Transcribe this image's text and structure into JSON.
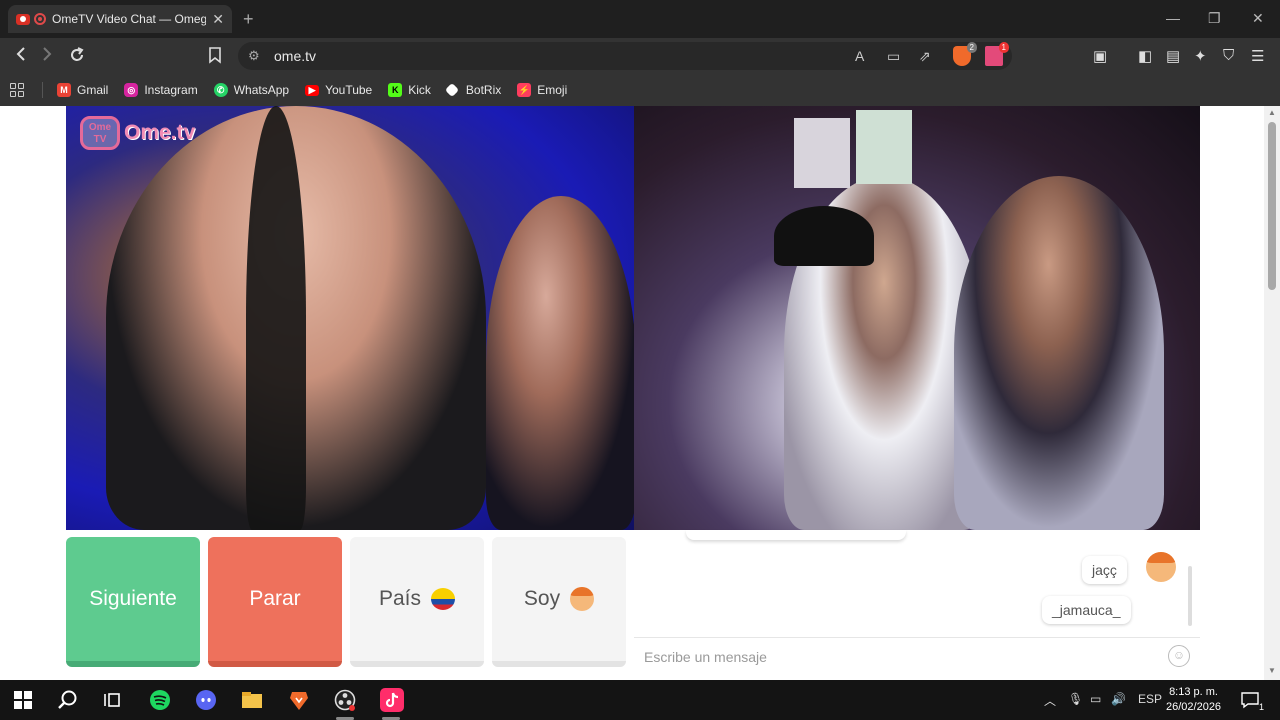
{
  "tab": {
    "title": "OmeTV Video Chat — Omegle",
    "close": "✕",
    "new_tab": "+"
  },
  "window": {
    "minimize": "—",
    "maximize": "❐",
    "close": "✕"
  },
  "address_bar": {
    "url": "ome.tv"
  },
  "extensions": {
    "brave_shields_badge": "2",
    "brave_rewards_badge": "1"
  },
  "bookmarks": [
    {
      "label": "Gmail",
      "icon": "gmail-icon",
      "color": "#ea4335"
    },
    {
      "label": "Instagram",
      "icon": "instagram-icon",
      "color": "#d6249f"
    },
    {
      "label": "WhatsApp",
      "icon": "whatsapp-icon",
      "color": "#25d366"
    },
    {
      "label": "YouTube",
      "icon": "youtube-icon",
      "color": "#ff0000"
    },
    {
      "label": "Kick",
      "icon": "kick-icon",
      "color": "#53fc18"
    },
    {
      "label": "BotRix",
      "icon": "botrix-icon",
      "color": "#ffffff"
    },
    {
      "label": "Emoji",
      "icon": "emoji-icon",
      "color": "#ff3d5e"
    }
  ],
  "site": {
    "logo_box_text": "Ome TV",
    "logo_text": "Ome.tv",
    "controls": {
      "next": "Siguiente",
      "stop": "Parar",
      "country": "País",
      "soy": "Soy"
    },
    "chat": {
      "messages": [
        "jaçç",
        "_jamauca_"
      ],
      "input_placeholder": "Escribe un mensaje"
    }
  },
  "taskbar": {
    "language": "ESP",
    "time": "8:13 p. m.",
    "date": "26/02/2026",
    "notifications_count": "1"
  }
}
